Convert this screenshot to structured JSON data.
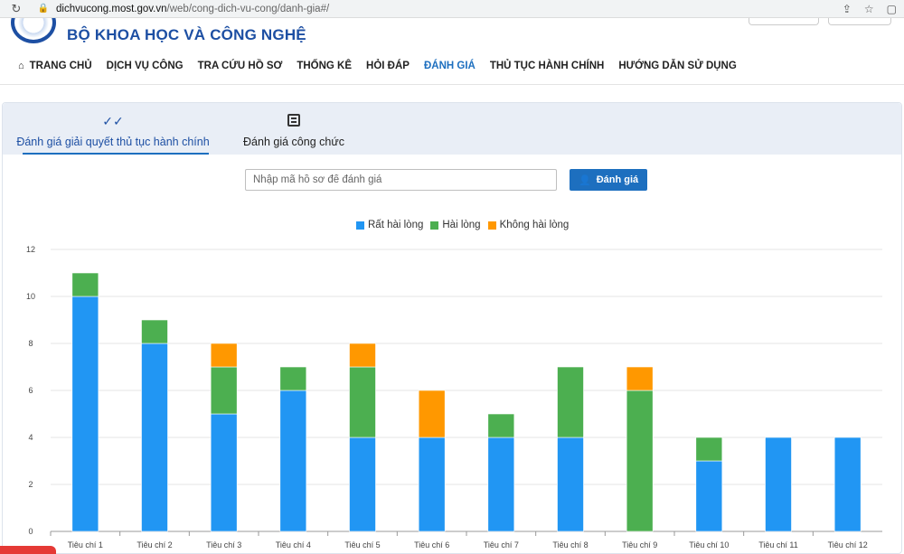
{
  "browser": {
    "url_host": "dichvucong.most.gov.vn",
    "url_path": "/web/cong-dich-vu-cong/danh-gia#/"
  },
  "site": {
    "title": "BỘ KHOA HỌC VÀ CÔNG NGHỆ"
  },
  "nav": {
    "items": [
      {
        "label": "TRANG CHỦ",
        "active": false
      },
      {
        "label": "DỊCH VỤ CÔNG",
        "active": false
      },
      {
        "label": "TRA CỨU HỒ SƠ",
        "active": false
      },
      {
        "label": "THỐNG KÊ",
        "active": false
      },
      {
        "label": "HỎI ĐÁP",
        "active": false
      },
      {
        "label": "ĐÁNH GIÁ",
        "active": true
      },
      {
        "label": "THỦ TỤC HÀNH CHÍNH",
        "active": false
      },
      {
        "label": "HƯỚNG DẪN SỬ DỤNG",
        "active": false
      }
    ]
  },
  "tabs": [
    {
      "label": "Đánh giá giải quyết thủ tục hành chính",
      "icon": "double-check-icon",
      "active": true
    },
    {
      "label": "Đánh giá công chức",
      "icon": "checklist-icon",
      "active": false
    }
  ],
  "search": {
    "placeholder": "Nhập mã hồ sơ để đánh giá",
    "button_label": "Đánh giá"
  },
  "colors": {
    "accent": "#1d6fbf",
    "brand": "#1d4fa3"
  },
  "chart_data": {
    "type": "bar",
    "stacked": true,
    "categories": [
      "Tiêu chí 1",
      "Tiêu chí 2",
      "Tiêu chí 3",
      "Tiêu chí 4",
      "Tiêu chí 5",
      "Tiêu chí 6",
      "Tiêu chí 7",
      "Tiêu chí 8",
      "Tiêu chí 9",
      "Tiêu chí 10",
      "Tiêu chí 11",
      "Tiêu chí 12"
    ],
    "series": [
      {
        "name": "Rất hài lòng",
        "color": "#2196f3",
        "values": [
          10,
          8,
          5,
          6,
          4,
          4,
          4,
          4,
          0,
          3,
          4,
          4
        ]
      },
      {
        "name": "Hài lòng",
        "color": "#4caf50",
        "values": [
          1,
          1,
          2,
          1,
          3,
          0,
          1,
          3,
          6,
          1,
          0,
          0
        ]
      },
      {
        "name": "Không hài lòng",
        "color": "#ff9800",
        "values": [
          0,
          0,
          1,
          0,
          1,
          2,
          0,
          0,
          1,
          0,
          0,
          0
        ]
      }
    ],
    "yticks": [
      "0",
      "2",
      "4",
      "6",
      "8",
      "10",
      "12"
    ],
    "ylim": [
      0,
      12
    ],
    "grid": true,
    "legend_position": "top-center"
  }
}
